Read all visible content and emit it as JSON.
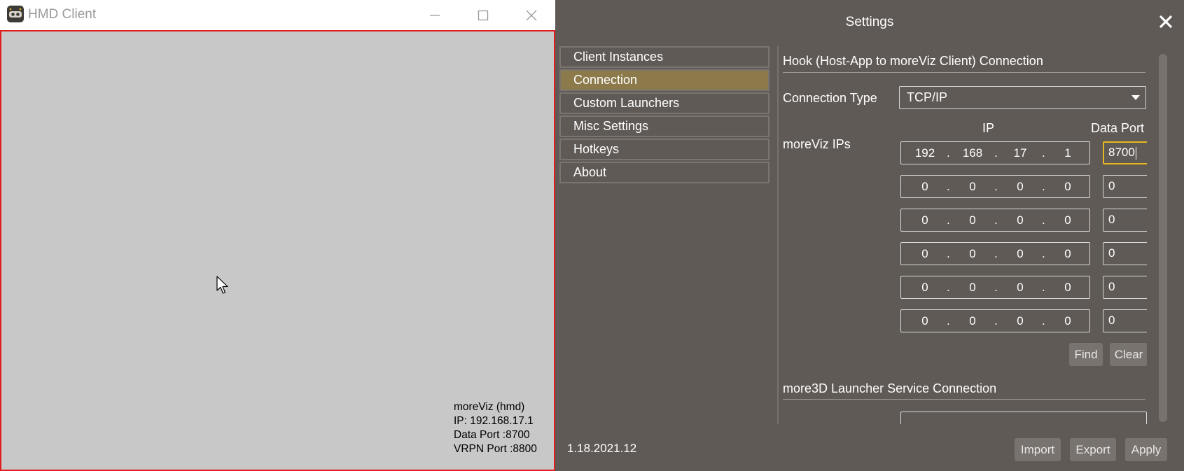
{
  "hmd_window": {
    "title": "HMD Client",
    "overlay": {
      "line1": "moreViz (hmd)",
      "line2": "IP: 192.168.17.1",
      "line3": "Data Port :8700",
      "line4": "VRPN Port :8800"
    },
    "canvas_color": "#c8c8c8",
    "border_color": "#e01c1c"
  },
  "settings": {
    "title": "Settings",
    "sidebar": [
      {
        "label": "Client Instances",
        "active": false
      },
      {
        "label": "Connection",
        "active": true
      },
      {
        "label": "Custom Launchers",
        "active": false
      },
      {
        "label": "Misc Settings",
        "active": false
      },
      {
        "label": "Hotkeys",
        "active": false
      },
      {
        "label": "About",
        "active": false
      }
    ],
    "hook_section": {
      "title": "Hook (Host-App to moreViz Client) Connection",
      "connection_type_label": "Connection Type",
      "connection_type_value": "TCP/IP",
      "ip_col": "IP",
      "port_col": "Data Port",
      "ips_label": "moreViz IPs",
      "rows": [
        {
          "o1": "192",
          "o2": "168",
          "o3": "17",
          "o4": "1",
          "port": "8700"
        },
        {
          "o1": "0",
          "o2": "0",
          "o3": "0",
          "o4": "0",
          "port": "0"
        },
        {
          "o1": "0",
          "o2": "0",
          "o3": "0",
          "o4": "0",
          "port": "0"
        },
        {
          "o1": "0",
          "o2": "0",
          "o3": "0",
          "o4": "0",
          "port": "0"
        },
        {
          "o1": "0",
          "o2": "0",
          "o3": "0",
          "o4": "0",
          "port": "0"
        },
        {
          "o1": "0",
          "o2": "0",
          "o3": "0",
          "o4": "0",
          "port": "0"
        }
      ],
      "find_label": "Find",
      "clear_label": "Clear"
    },
    "launcher_section": {
      "title": "more3D Launcher Service Connection"
    },
    "version": "1.18.2021.12",
    "import_label": "Import",
    "export_label": "Export",
    "apply_label": "Apply",
    "accent_color": "#8c7a4a",
    "focus_color": "#e6b820"
  }
}
